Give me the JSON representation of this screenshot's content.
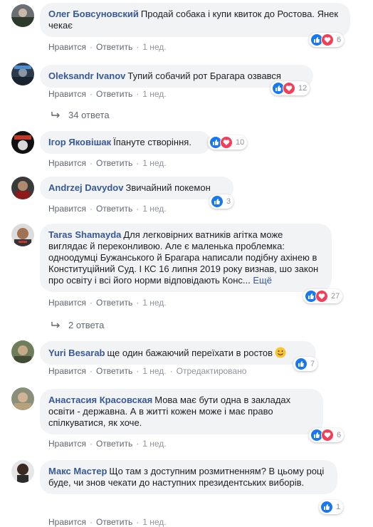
{
  "comments": [
    {
      "name": "Олег Бовсуновский",
      "text": "Продай собака і купи квиток до Ростова. Янек чекає",
      "actions": [
        "Нравится",
        "Ответить",
        "1 нед."
      ],
      "reactions": "6"
    },
    {
      "name": "Oleksandr Ivanov",
      "text": "Тупий собачий рот Брагара озвався",
      "actions": [
        "Нравится",
        "Ответить",
        "1 нед."
      ],
      "reactions": "12"
    },
    {
      "name": "Ігор Яковішак",
      "text": "Їпануте створіння.",
      "actions": [
        "Нравится",
        "Ответить",
        "1 нед."
      ],
      "reactions": "10"
    },
    {
      "name": "Andrzej Davydov",
      "text": "Звичайний покемон",
      "actions": [
        "Нравится",
        "Ответить",
        "1 нед."
      ],
      "reactions": "3"
    },
    {
      "name": "Taras Shamayda",
      "text": "Для легковірних ватників агітка може виглядає й переконливою. Але є маленька проблемка: одноодумці Бужанського й Брагара написали подібну ахінею в Конституційний Суд. І КС 16 липня 2019 року визнав, шо закон про освіту і всі його норми відповідають Конс...",
      "more": "Ещё",
      "actions": [
        "Нравится",
        "Ответить",
        "1 нед."
      ],
      "reactions": "27"
    },
    {
      "name": "Yuri Besarab",
      "text": "ще один бажаючий переїхати в ростов",
      "actions": [
        "Нравится",
        "Ответить",
        "1 нед.",
        "Отредактировано"
      ],
      "reactions": "7"
    },
    {
      "name": "Анастасия Красовская",
      "text": "Мова має бути одна в закладах освіти - державна. А в житті кожен може і має право спілкуватися, як хоче.",
      "actions": [
        "Нравится",
        "Ответить",
        "1 нед."
      ],
      "reactions": "6"
    },
    {
      "name": "Макс Мастер",
      "text": "Що там з доступним розмитненням? В цьому році буде, чи знов чекати до наступних президентських виборів.",
      "actions": [
        "Нравится",
        "Ответить",
        "1 нед."
      ],
      "reactions": "1"
    }
  ],
  "reply_links": [
    "34 ответа",
    "2 ответа"
  ],
  "colors": {
    "name": "#385898",
    "like": "#1877f2",
    "love": "#f33e58",
    "bubble": "#f2f3f5"
  },
  "icons": {
    "like": "like-icon",
    "love": "love-icon",
    "reply_arrow": "reply-arrow-icon",
    "smile": "smile-emoji"
  }
}
